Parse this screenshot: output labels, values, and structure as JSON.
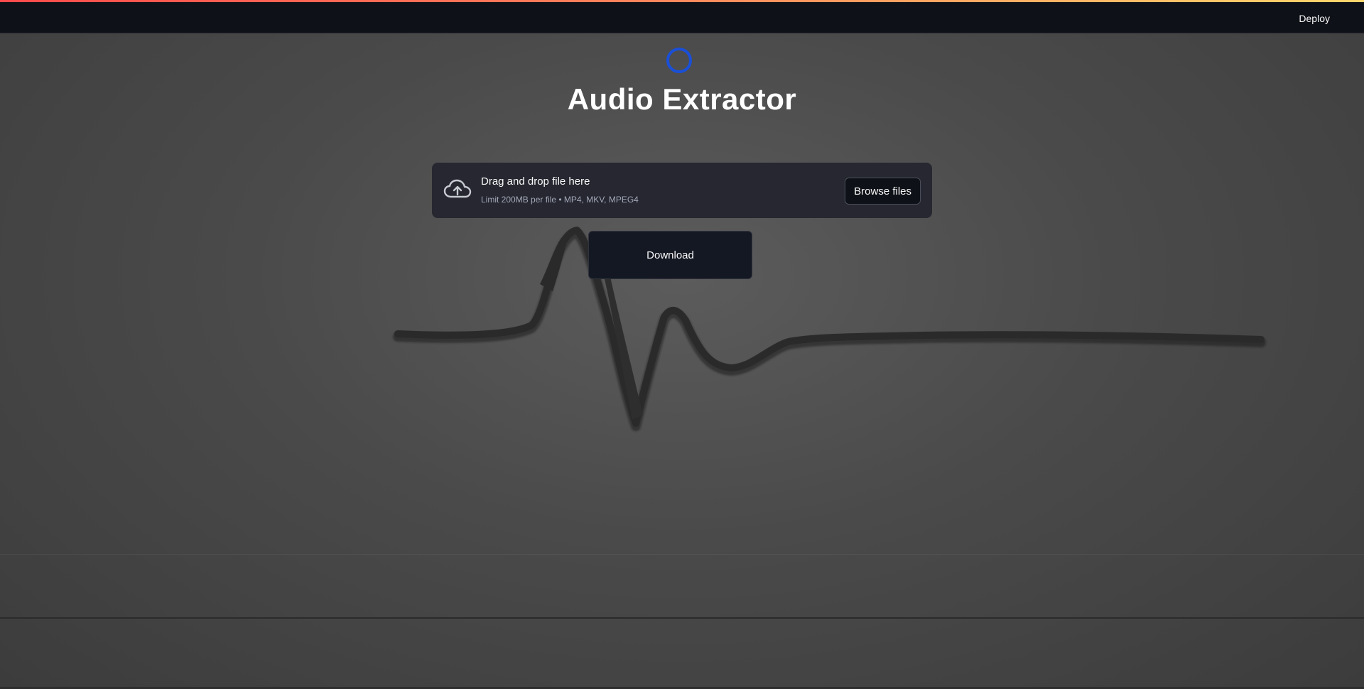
{
  "header": {
    "deploy_label": "Deploy"
  },
  "app": {
    "title": "Audio Extractor"
  },
  "uploader": {
    "drag_label": "Drag and drop file here",
    "limit_text": "Limit 200MB per file • MP4, MKV, MPEG4",
    "browse_label": "Browse files",
    "icon": "cloud-upload-icon"
  },
  "actions": {
    "download_label": "Download"
  },
  "colors": {
    "header_bg": "#0e1117",
    "spinner": "#1a4fd8",
    "panel_bg": "#262730",
    "button_bg": "#141823"
  }
}
